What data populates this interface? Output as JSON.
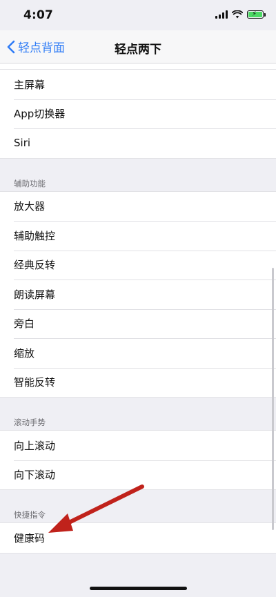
{
  "status_bar": {
    "time": "4:07"
  },
  "nav": {
    "back_label": "轻点背面",
    "title": "轻点两下"
  },
  "sections": {
    "system": {
      "items": [
        "主屏幕",
        "App切换器",
        "Siri"
      ]
    },
    "accessibility": {
      "header": "辅助功能",
      "items": [
        "放大器",
        "辅助触控",
        "经典反转",
        "朗读屏幕",
        "旁白",
        "缩放",
        "智能反转"
      ]
    },
    "scroll_gestures": {
      "header": "滚动手势",
      "items": [
        "向上滚动",
        "向下滚动"
      ]
    },
    "shortcuts": {
      "header": "快捷指令",
      "items": [
        "健康码"
      ]
    }
  },
  "colors": {
    "accent": "#2f7cf6",
    "arrow": "#c0221b",
    "battery": "#4cd964"
  }
}
